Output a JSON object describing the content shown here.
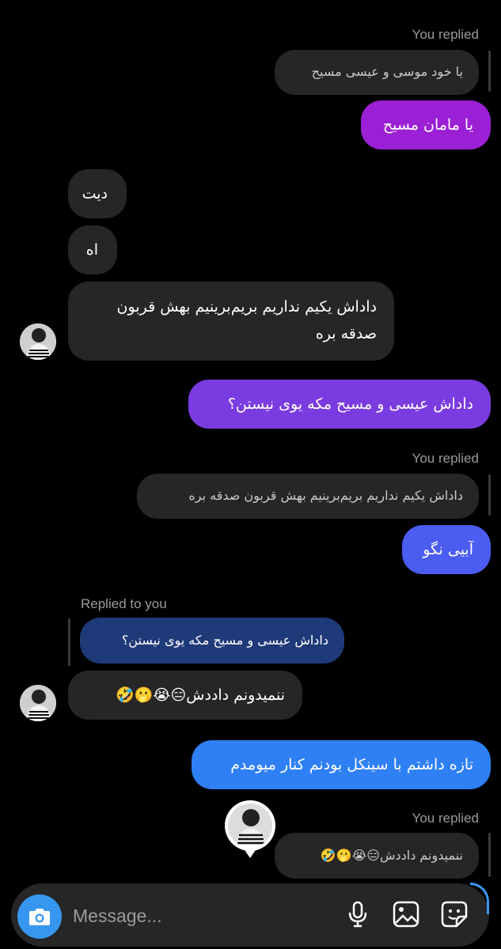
{
  "thread": {
    "replied_1": "You replied",
    "quote_1": "یا خود موسی و عیسی مسیح",
    "msg_1": "یا مامان مسیح",
    "msg_2": "دیت",
    "msg_3": "اه",
    "msg_4_line1": "داداش یکیم نداریم بریم‌برینیم بهش قربون",
    "msg_4_line2": "صدقه بره",
    "msg_5": "داداش عیسی و مسیح مکه یوی نیستن؟",
    "replied_2": "You replied",
    "quote_2": "داداش یکیم نداریم بریم‌برینیم بهش قربون صدقه بره",
    "msg_6": "آبیی نگو",
    "replied_to_you": "Replied to you",
    "quote_3": "داداش عیسی و مسیح مکه یوی نیستن؟",
    "msg_7": "ننمیدونم داددش😑😭🫢🤣",
    "msg_8": "تازه داشتم با سینکل بودنم کنار میومدم",
    "replied_3": "You replied",
    "quote_4": "ننمیدونم داددش😑😭🫢🤣"
  },
  "composer": {
    "placeholder": "Message..."
  },
  "icons": {
    "camera": "camera-icon",
    "mic": "microphone-icon",
    "gallery": "gallery-icon",
    "sticker": "sticker-icon"
  },
  "colors": {
    "background": "#000000",
    "incoming_bubble": "#262626",
    "outgoing_purple": "#9b1fd4",
    "outgoing_violet": "#7a3be0",
    "outgoing_indigo": "#4b5cf0",
    "outgoing_blue": "#2f80f5",
    "camera_button": "#3797f0"
  }
}
